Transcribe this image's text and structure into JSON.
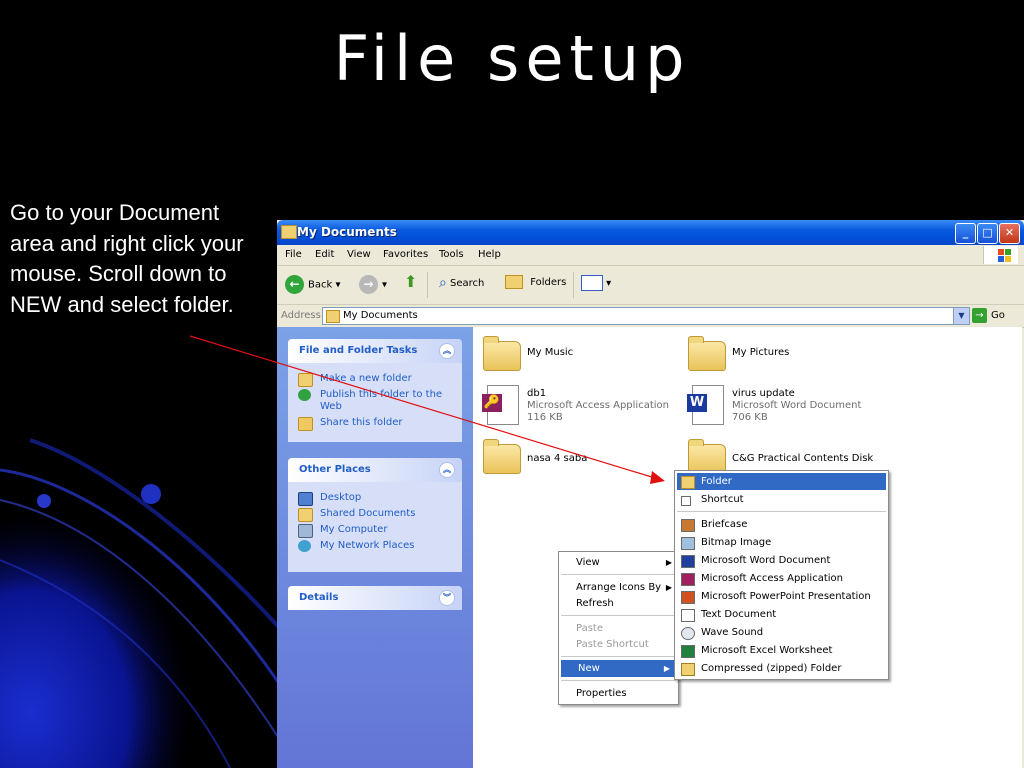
{
  "slide": {
    "title": "File setup",
    "instruction": "Go to your Document area and right click your mouse. Scroll down to NEW and select folder."
  },
  "window": {
    "title": "My Documents",
    "buttons": {
      "minimize": "_",
      "maximize": "□",
      "close": "✕"
    },
    "menubar": [
      "File",
      "Edit",
      "View",
      "Favorites",
      "Tools",
      "Help"
    ],
    "toolbar": {
      "back": "Back",
      "search": "Search",
      "folders": "Folders"
    },
    "address": {
      "label": "Address",
      "value": "My Documents",
      "go": "Go"
    }
  },
  "left_pane": {
    "file_folder_tasks": {
      "title": "File and Folder Tasks",
      "items": [
        "Make a new folder",
        "Publish this folder to the Web",
        "Share this folder"
      ]
    },
    "other_places": {
      "title": "Other Places",
      "items": [
        "Desktop",
        "Shared Documents",
        "My Computer",
        "My Network Places"
      ]
    },
    "details": {
      "title": "Details"
    }
  },
  "files": [
    {
      "name": "My Music"
    },
    {
      "name": "My Pictures"
    },
    {
      "name": "db1",
      "type": "Microsoft Access Application",
      "size": "116 KB"
    },
    {
      "name": "virus update",
      "type": "Microsoft Word Document",
      "size": "706 KB"
    },
    {
      "name": "nasa 4 saba"
    },
    {
      "name": "C&G Practical Contents Disk"
    }
  ],
  "context_menu": {
    "items": [
      "View",
      "Arrange Icons By",
      "Refresh",
      "Paste",
      "Paste Shortcut",
      "New",
      "Properties"
    ]
  },
  "new_submenu": {
    "items": [
      "Folder",
      "Shortcut",
      "Briefcase",
      "Bitmap Image",
      "Microsoft Word Document",
      "Microsoft Access Application",
      "Microsoft PowerPoint Presentation",
      "Text Document",
      "Wave Sound",
      "Microsoft Excel Worksheet",
      "Compressed (zipped) Folder"
    ]
  },
  "colors": {
    "slide_bg": "#000000",
    "accent_blue": "#0a1aa0",
    "xp_title": "#0050d8",
    "highlight": "#316ac5",
    "task_link": "#215dc6",
    "arrow": "#e01010"
  }
}
